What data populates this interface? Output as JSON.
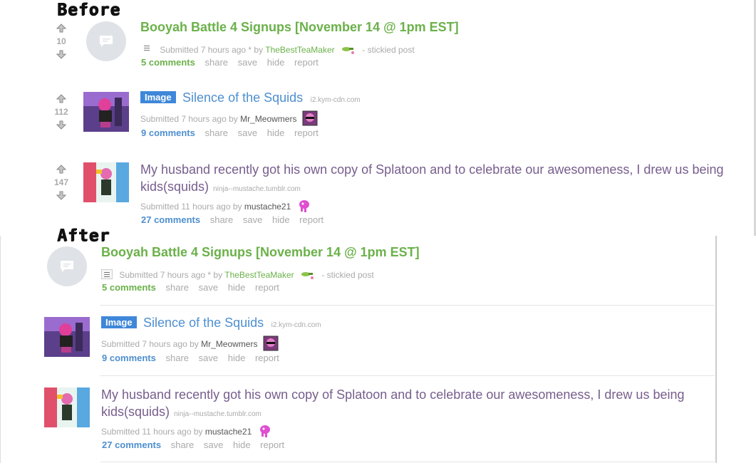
{
  "labels": {
    "before": "Before",
    "after": "After"
  },
  "posts": [
    {
      "title": "Booyah Battle 4 Signups [November 14 @ 1pm EST]",
      "score": "10",
      "submitted": "Submitted 7 hours ago * by",
      "author": "TheBestTeaMaker",
      "suffix": "- stickied post",
      "comments": "5 comments",
      "share": "share",
      "save": "save",
      "hide": "hide",
      "report": "report"
    },
    {
      "flair": "Image",
      "title": "Silence of the Squids",
      "domain": "i2.kym-cdn.com",
      "score": "112",
      "submitted": "Submitted 7 hours ago by",
      "author": "Mr_Meowmers",
      "comments": "9 comments",
      "share": "share",
      "save": "save",
      "hide": "hide",
      "report": "report"
    },
    {
      "title_line1": "My husband recently got his own copy of Splatoon and to celebrate our awesomeness, I drew us being",
      "title_line2": "kids(squids)",
      "domain": "ninja--mustache.tumblr.com",
      "score": "147",
      "submitted": "Submitted 11 hours ago by",
      "author": "mustache21",
      "comments": "27 comments",
      "share": "share",
      "save": "save",
      "hide": "hide",
      "report": "report"
    }
  ],
  "colors": {
    "stickied": "#6bb14a",
    "link": "#4e8fcf",
    "visited": "#775e8d",
    "flair": "#3e87d9"
  }
}
